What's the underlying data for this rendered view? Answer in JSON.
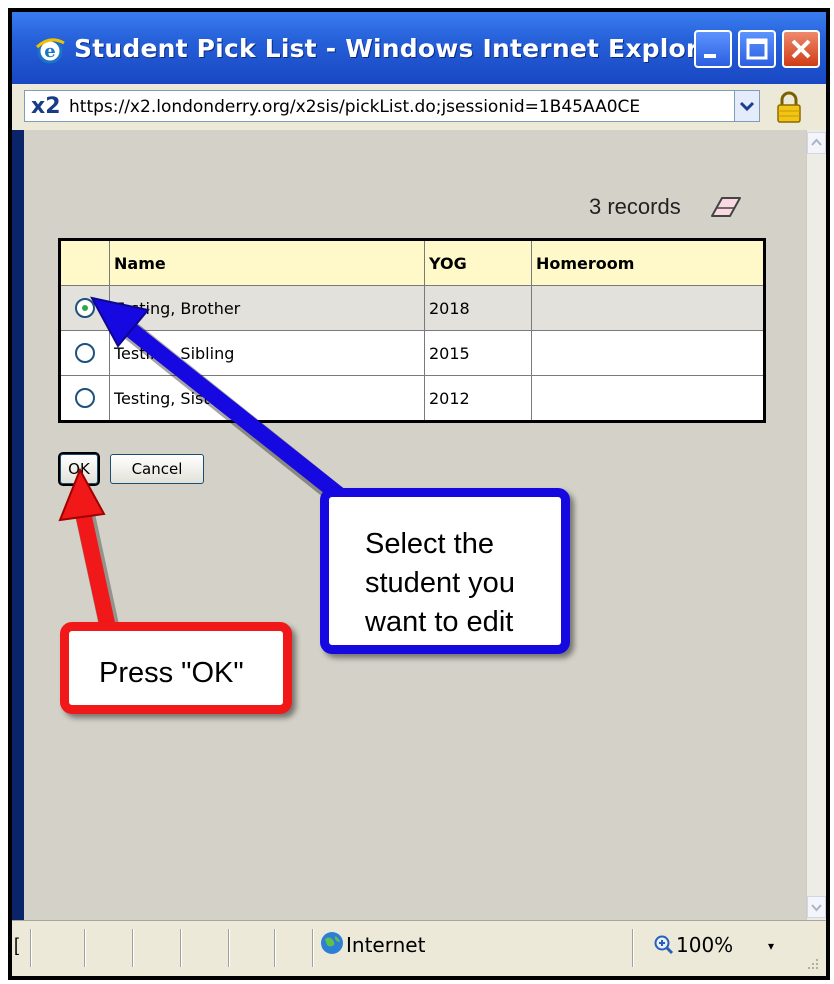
{
  "window": {
    "title": "Student Pick List - Windows Internet Explorer",
    "address_logo": "x2",
    "url": "https://x2.londonderry.org/x2sis/pickList.do;jsessionid=1B45AA0CE"
  },
  "picklist": {
    "record_count": "3 records",
    "columns": [
      "Name",
      "YOG",
      "Homeroom"
    ],
    "rows": [
      {
        "name": "Testing, Brother",
        "yog": "2018",
        "homeroom": "",
        "selected": true
      },
      {
        "name": "Testing, Sibling",
        "yog": "2015",
        "homeroom": "",
        "selected": false
      },
      {
        "name": "Testing, Sister",
        "yog": "2012",
        "homeroom": "",
        "selected": false
      }
    ],
    "ok_label": "OK",
    "cancel_label": "Cancel"
  },
  "callouts": {
    "select_text": "Select the\nstudent you\nwant to edit",
    "ok_text": "Press \"OK\""
  },
  "status": {
    "left_glyph": "[",
    "zone": "Internet",
    "zoom": "100%",
    "zoom_dropdown": "▾"
  },
  "colors": {
    "titlebar": "#2560d8",
    "callout_blue": "#1608e0",
    "callout_red": "#f01818",
    "header_yellow": "#fff9c9"
  }
}
